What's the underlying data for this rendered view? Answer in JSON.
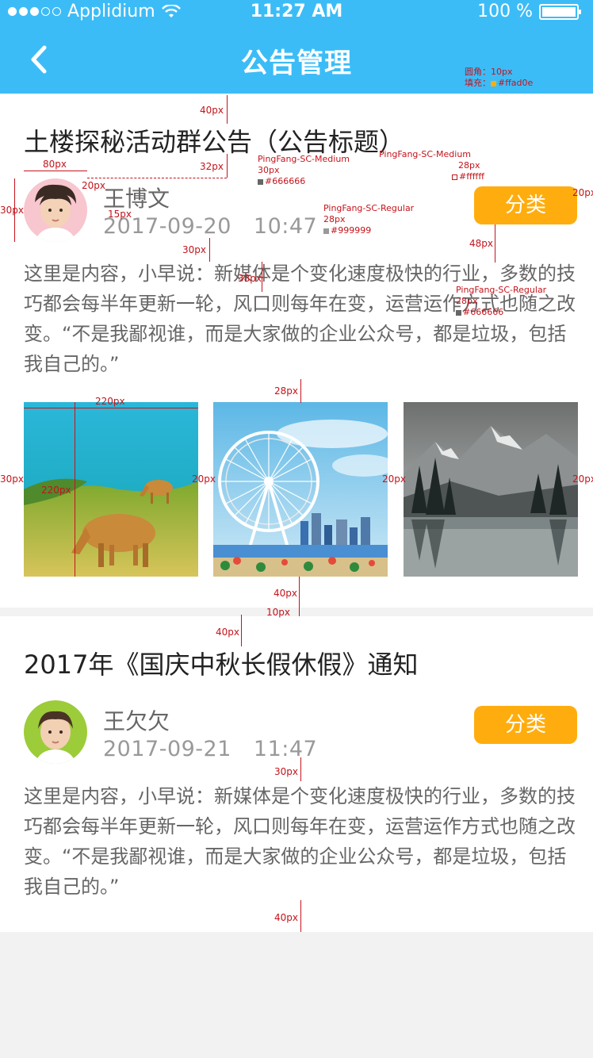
{
  "status_bar": {
    "carrier": "Applidium",
    "time": "11:27 AM",
    "battery": "100 %",
    "battery_level": 1.0
  },
  "nav": {
    "title": "公告管理",
    "back_icon": "chevron-left-icon"
  },
  "posts": [
    {
      "title": "土楼探秘活动群公告（公告标题）",
      "author": "王博文",
      "date": "2017-09-20",
      "time": "10:47",
      "category": "分类",
      "content": "这里是内容，小早说：新媒体是个变化速度极快的行业，多数的技巧都会每半年更新一轮，风口则每年在变，运营运作方式也随之改变。“不是我鄙视谁，而是大家做的企业公众号，都是垃圾，包括我自己的。”",
      "images": [
        "cow-on-grass-photo",
        "ferris-wheel-photo",
        "mountain-lake-photo"
      ]
    },
    {
      "title": "2017年《国庆中秋长假休假》通知",
      "author": "王欠欠",
      "date": "2017-09-21",
      "time": "11:47",
      "category": "分类",
      "content": "这里是内容，小早说：新媒体是个变化速度极快的行业，多数的技巧都会每半年更新一轮，风口则每年在变，运营运作方式也随之改变。“不是我鄙视谁，而是大家做的企业公众号，都是垃圾，包括我自己的。”"
    }
  ],
  "annotations": {
    "radius_label": "圆角：10px",
    "fill_label": "填充：",
    "fill_color": "#ffad0e",
    "medium_font": "PingFang-SC-Medium",
    "regular_font": "PingFang-SC-Regular",
    "size_30": "30px",
    "size_28": "28px",
    "color_666": "#666666",
    "color_999": "#999999",
    "color_fff": "#ffffff",
    "d40": "40px",
    "d32": "32px",
    "d80": "80px",
    "d20": "20px",
    "d15": "15px",
    "d30": "30px",
    "d38": "38px",
    "d48": "48px",
    "d28": "28px",
    "d220": "220px",
    "d10": "10px",
    "d20b": "20px",
    "d30b": "30px"
  }
}
